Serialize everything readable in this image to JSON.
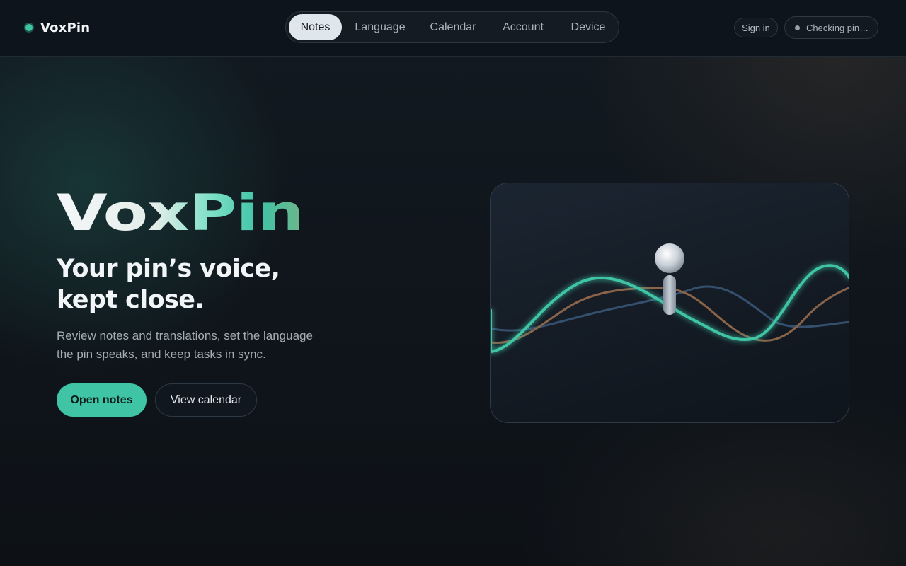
{
  "brand": {
    "name": "VoxPin"
  },
  "nav": {
    "items": [
      {
        "label": "Notes",
        "active": true
      },
      {
        "label": "Language",
        "active": false
      },
      {
        "label": "Calendar",
        "active": false
      },
      {
        "label": "Account",
        "active": false
      },
      {
        "label": "Device",
        "active": false
      }
    ]
  },
  "header": {
    "sign_in_label": "Sign in",
    "status_label": "Checking pin…"
  },
  "hero": {
    "title": "VoxPin",
    "subtitle_line1": "Your pin’s voice,",
    "subtitle_line2": "kept close.",
    "description_line1": "Review notes and translations, set the language",
    "description_line2": "the pin speaks, and keep tasks in sync.",
    "primary_button": "Open notes",
    "secondary_button": "View calendar"
  },
  "colors": {
    "accent": "#3fc4a6",
    "wave_secondary": "#8a6448",
    "wave_tertiary": "#34506e",
    "background": "#0f141a"
  },
  "illustration": {
    "icons": [
      "pin-device-icon",
      "voice-waveform-icon"
    ]
  }
}
